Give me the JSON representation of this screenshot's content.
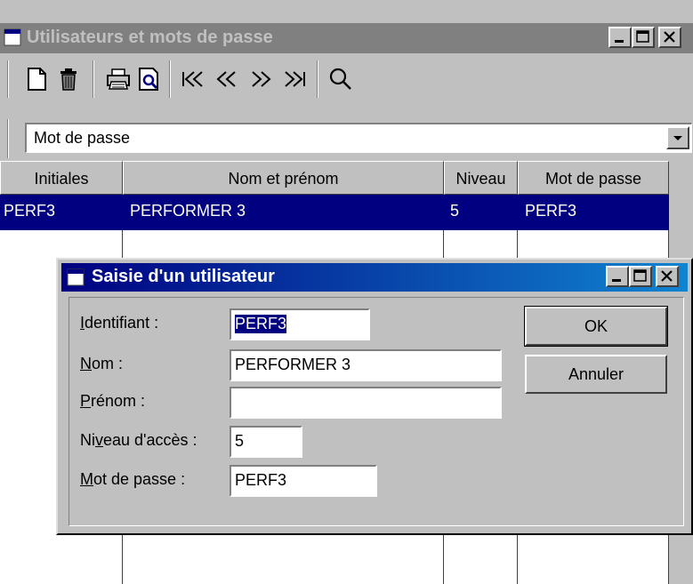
{
  "window": {
    "title": "Utilisateurs et mots de passe"
  },
  "toolbar": {
    "icons": [
      "new-document-icon",
      "delete-trash-icon",
      "print-icon",
      "print-preview-icon",
      "first-record-icon",
      "previous-record-icon",
      "next-record-icon",
      "last-record-icon",
      "search-icon"
    ]
  },
  "filter": {
    "selected": "Mot de passe"
  },
  "table": {
    "headers": [
      "Initiales",
      "Nom et prénom",
      "Niveau",
      "Mot de passe"
    ],
    "rows": [
      {
        "initiales": "PERF3",
        "nom": "PERFORMER 3",
        "niveau": "5",
        "mot_de_passe": "PERF3"
      }
    ]
  },
  "dialog": {
    "title": "Saisie d'un utilisateur",
    "fields": {
      "identifiant": {
        "pre": "",
        "acc": "I",
        "post": "dentifiant :",
        "value": "PERF3"
      },
      "nom": {
        "pre": "",
        "acc": "N",
        "post": "om :",
        "value": "PERFORMER 3"
      },
      "prenom": {
        "pre": "",
        "acc": "P",
        "post": "rénom :",
        "value": ""
      },
      "niveau": {
        "pre": "Ni",
        "acc": "v",
        "post": "eau d'accès :",
        "value": "5"
      },
      "mot_de_passe": {
        "pre": "",
        "acc": "M",
        "post": "ot de passe :",
        "value": "PERF3"
      }
    },
    "ok_label": "OK",
    "cancel_label": "Annuler"
  },
  "colors": {
    "selection": "#000080",
    "face": "#c0c0c0",
    "inactive_title": "#808080",
    "active_title_start": "#000080",
    "active_title_end": "#1084d0"
  }
}
